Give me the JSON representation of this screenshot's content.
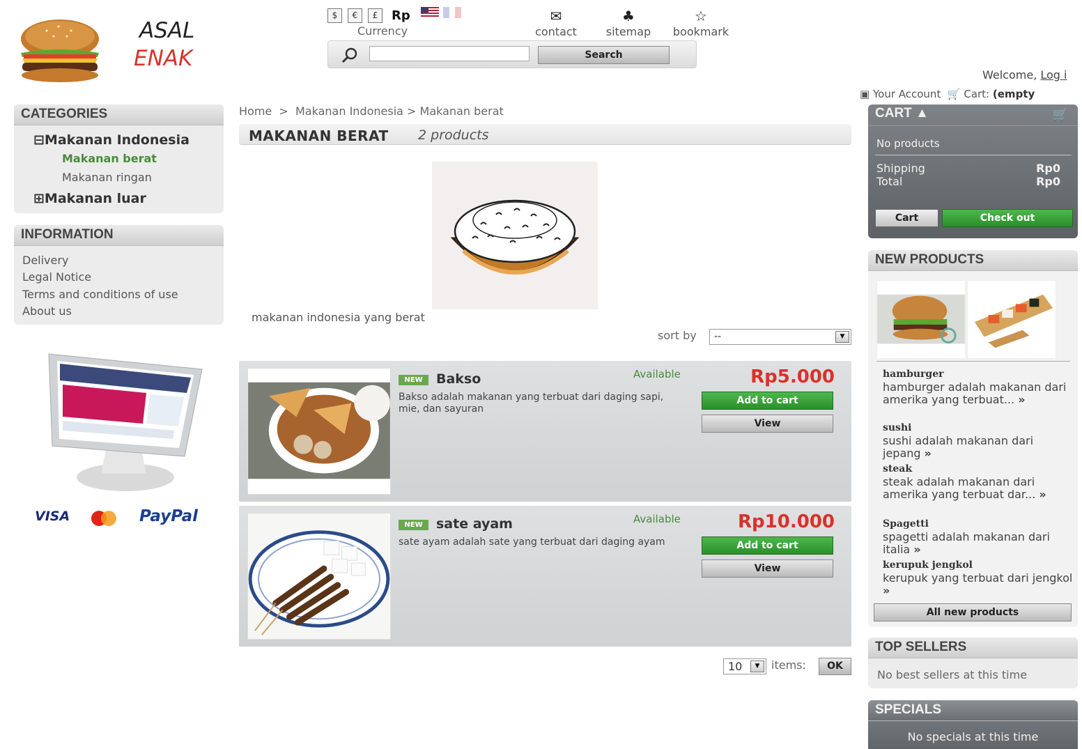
{
  "header": {
    "brand_line1": "ASAL",
    "brand_line2": "ENAK",
    "currency": {
      "symbols": [
        "$",
        "€",
        "£"
      ],
      "selected": "Rp",
      "label": "Currency"
    },
    "links": [
      {
        "label": "contact",
        "icon": "envelope-icon"
      },
      {
        "label": "sitemap",
        "icon": "sitemap-icon"
      },
      {
        "label": "bookmark",
        "icon": "star-icon"
      }
    ],
    "search": {
      "button": "Search",
      "value": ""
    },
    "welcome_prefix": "Welcome,",
    "login_link": "Log i",
    "account_label": "Your Account",
    "cart_label": "Cart:",
    "cart_status": "(empty"
  },
  "categories": {
    "title": "CATEGORIES",
    "items": [
      {
        "label": "Makanan Indonesia",
        "toggle": "⊟"
      },
      {
        "label": "Makanan berat",
        "active": true
      },
      {
        "label": "Makanan ringan"
      },
      {
        "label": "Makanan luar",
        "toggle": "⊞"
      }
    ]
  },
  "information": {
    "title": "INFORMATION",
    "items": [
      "Delivery",
      "Legal Notice",
      "Terms and conditions of use",
      "About us"
    ]
  },
  "payments": {
    "visa": "VISA",
    "mastercard": "MasterCard",
    "paypal": "PayPal"
  },
  "main": {
    "breadcrumb": {
      "home": "Home",
      "sep1": ">",
      "parent": "Makanan Indonesia",
      "sep2": ">",
      "current": "Makanan berat"
    },
    "category_title": "MAKANAN BERAT",
    "product_count": "2 products",
    "category_desc": "makanan indonesia yang berat",
    "sort_label": "sort by",
    "sort_value": "--",
    "products": [
      {
        "badge": "NEW",
        "name": "Bakso",
        "availability": "Available",
        "desc": "Bakso adalah makanan yang terbuat dari daging sapi, mie, dan sayuran",
        "price": "Rp5.000",
        "add_label": "Add to cart",
        "view_label": "View"
      },
      {
        "badge": "NEW",
        "name": "sate ayam",
        "availability": "Available",
        "desc": "sate ayam adalah sate yang terbuat dari daging ayam",
        "price": "Rp10.000",
        "add_label": "Add to cart",
        "view_label": "View"
      }
    ],
    "pagination": {
      "per_page": "10",
      "items_label": "items:",
      "ok_label": "OK"
    }
  },
  "cart_block": {
    "title": "CART",
    "empty_text": "No products",
    "shipping_label": "Shipping",
    "shipping_value": "Rp0",
    "total_label": "Total",
    "total_value": "Rp0",
    "cart_button": "Cart",
    "checkout_button": "Check out"
  },
  "new_products": {
    "title": "NEW PRODUCTS",
    "items": [
      {
        "name": "hamburger",
        "desc": "hamburger adalah makanan dari amerika yang terbuat...",
        "more": "»"
      },
      {
        "name": "sushi",
        "desc": "sushi adalah makanan dari jepang",
        "more": "»"
      },
      {
        "name": "steak",
        "desc": "steak adalah makanan dari amerika yang terbuat dar...",
        "more": "»"
      },
      {
        "name": "Spagetti",
        "desc": "spagetti adalah makanan dari italia",
        "more": "»"
      },
      {
        "name": "kerupuk jengkol",
        "desc": "kerupuk yang terbuat dari jengkol",
        "more": "»"
      }
    ],
    "all_button": "All new products"
  },
  "top_sellers": {
    "title": "TOP SELLERS",
    "empty_text": "No best sellers at this time"
  },
  "specials": {
    "title": "SPECIALS",
    "empty_text": "No specials at this time"
  }
}
